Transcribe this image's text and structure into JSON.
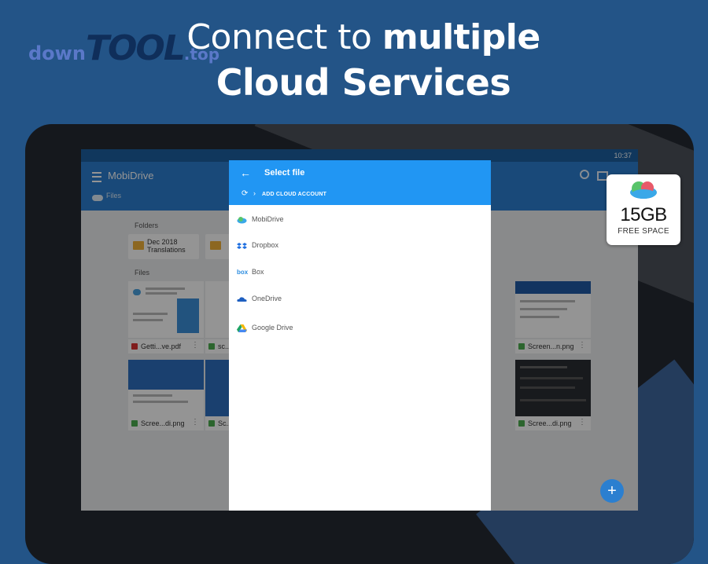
{
  "headline": {
    "line1_plain": "Connect to ",
    "line1_bold": "multiple",
    "line2": "Cloud Services"
  },
  "watermark": {
    "part1": "down",
    "part2": "TOOL",
    "part3": ".top"
  },
  "device": {
    "status_time": "10:37",
    "app_title": "MobiDrive",
    "breadcrumb": "Files",
    "folders_label": "Folders",
    "files_label": "Files",
    "folders": [
      "Dec 2018 Translations",
      ""
    ],
    "files": [
      {
        "name": "Getti...ve.pdf",
        "type": "pdf"
      },
      {
        "name": "sc...",
        "type": "image"
      },
      {
        "name": "",
        "type": "image"
      },
      {
        "name": "Screen...n.png",
        "type": "image"
      },
      {
        "name": "Scree...di.png",
        "type": "image"
      },
      {
        "name": "Sc...",
        "type": "image"
      },
      {
        "name": "",
        "type": "image"
      },
      {
        "name": "Scree...di.png",
        "type": "image"
      }
    ],
    "fab_label": "+"
  },
  "dialog": {
    "title": "Select file",
    "add_account": "ADD CLOUD ACCOUNT",
    "services": [
      {
        "label": "MobiDrive",
        "icon": "mobidrive-cloud-icon",
        "color": "#3aa8e8"
      },
      {
        "label": "Dropbox",
        "icon": "dropbox-icon",
        "color": "#1f6fe0"
      },
      {
        "label": "Box",
        "icon": "box-icon",
        "color": "#2e8ee0"
      },
      {
        "label": "OneDrive",
        "icon": "onedrive-icon",
        "color": "#1e5fc0"
      },
      {
        "label": "Google Drive",
        "icon": "google-drive-icon",
        "color": "#f5b800"
      }
    ]
  },
  "storage_badge": {
    "size": "15GB",
    "label": "FREE SPACE"
  }
}
